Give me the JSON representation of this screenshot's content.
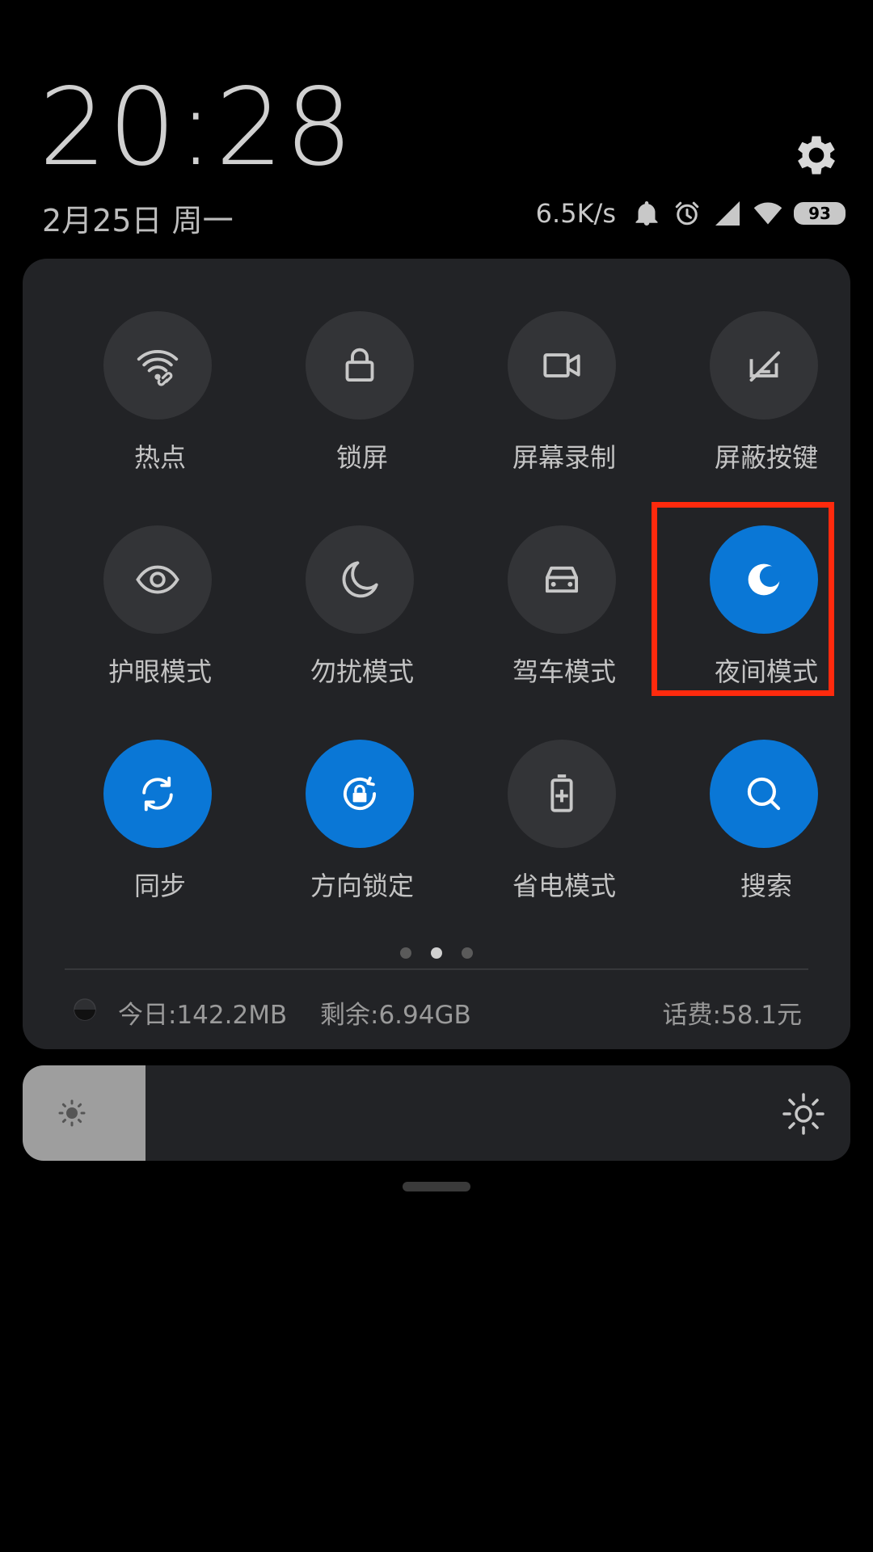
{
  "status": {
    "time": "20:28",
    "date": "2月25日 周一",
    "net_speed": "6.5K/s",
    "battery": "93",
    "icons": [
      "bell-icon",
      "alarm-icon",
      "signal-icon",
      "wifi-icon",
      "battery-icon",
      "gear-icon"
    ]
  },
  "tiles": [
    {
      "label": "热点",
      "icon": "hotspot-icon",
      "active": false
    },
    {
      "label": "锁屏",
      "icon": "lock-icon",
      "active": false
    },
    {
      "label": "屏幕录制",
      "icon": "video-camera-icon",
      "active": false
    },
    {
      "label": "屏蔽按键",
      "icon": "block-keys-icon",
      "active": false
    },
    {
      "label": "护眼模式",
      "icon": "eye-icon",
      "active": false
    },
    {
      "label": "勿扰模式",
      "icon": "moon-icon",
      "active": false
    },
    {
      "label": "驾车模式",
      "icon": "car-icon",
      "active": false
    },
    {
      "label": "夜间模式",
      "icon": "night-mode-icon",
      "active": true
    },
    {
      "label": "同步",
      "icon": "sync-icon",
      "active": true
    },
    {
      "label": "方向锁定",
      "icon": "rotation-lock-icon",
      "active": true
    },
    {
      "label": "省电模式",
      "icon": "battery-saver-icon",
      "active": false
    },
    {
      "label": "搜索",
      "icon": "search-icon",
      "active": true
    }
  ],
  "pager": {
    "total": 3,
    "current": 2
  },
  "data_usage": {
    "today": "今日:142.2MB",
    "remaining": "剩余:6.94GB",
    "fee": "话费:58.1元"
  },
  "brightness": {
    "level": 0.148
  },
  "colors": {
    "accent": "#0a77d6",
    "highlight": "#ff2a0d",
    "tile_bg": "#333437",
    "panel_bg": "#222326"
  }
}
